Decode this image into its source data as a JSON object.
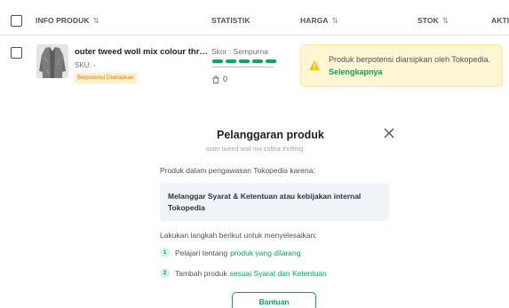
{
  "table": {
    "headers": {
      "info_produk": "INFO PRODUK",
      "statistik": "STATISTIK",
      "harga": "HARGA",
      "stok": "STOK",
      "aksi": "AKTI"
    },
    "row": {
      "name": "outer tweed woll mix colour thrif...",
      "sku": "SKU: -",
      "badge": "Berpotensi Diarsipkan",
      "skor": "Skor : Sempurna",
      "skor_level": 1.0,
      "views": "0"
    },
    "alert": {
      "text": "Produk berpotensi diarsipkan oleh Tokopedia.",
      "link": "Selengkapnya"
    }
  },
  "modal": {
    "title": "Pelanggaran produk",
    "subtitle": "outer tweed woll mix colour thrifting",
    "intro": "Produk dalam pengawasan Tokopedia karena:",
    "reason": "Melanggar Syarat & Ketentuan atau kebijakan internal Tokopedia",
    "steps_title": "Lakukan langkah berikut untuk menyelesaikan:",
    "steps": [
      {
        "num": "1",
        "text": "Pelajari tentang",
        "link": "produk yang dilarang"
      },
      {
        "num": "2",
        "text": "Tambah produk",
        "link": "sesuai Syarat dan Ketentuan"
      }
    ],
    "help_button": "Bantuan"
  },
  "colors": {
    "green": "#00aa5b",
    "warning_bg": "#fff6d4",
    "badge_text": "#e57c00"
  }
}
